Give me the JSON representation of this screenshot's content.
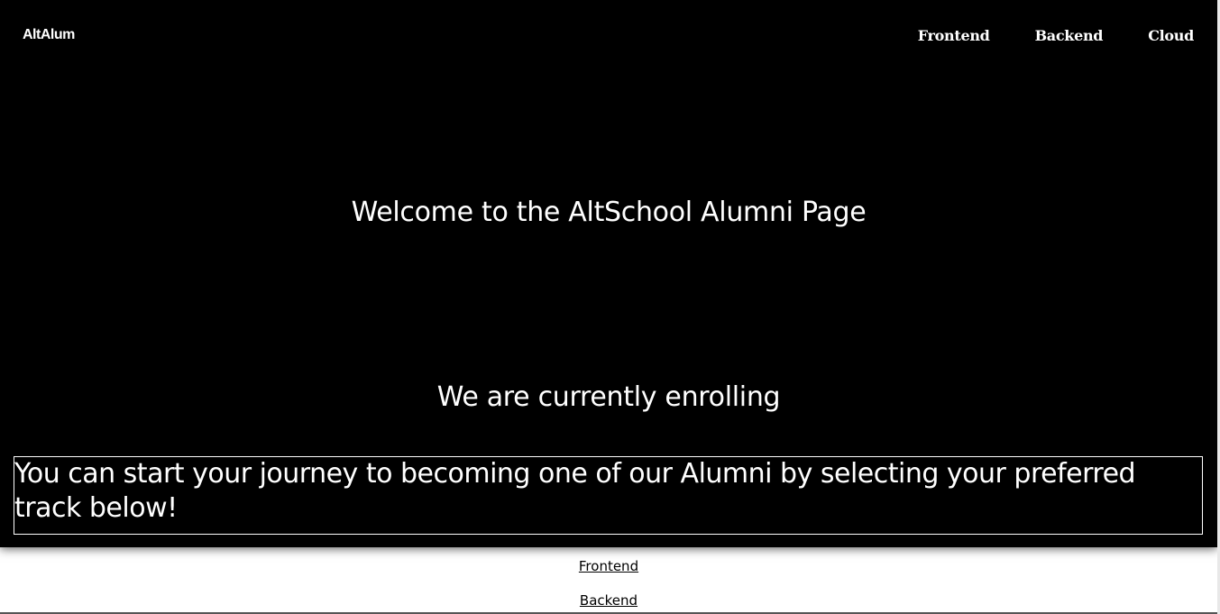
{
  "header": {
    "brand": "AltAlum",
    "nav": [
      "Frontend",
      "Backend",
      "Cloud"
    ]
  },
  "hero": {
    "welcome": "Welcome to the AltSchool Alumni Page",
    "enrolling": "We are currently enrolling",
    "journey": "You can start your journey to becoming one of our Alumni by selecting your preferred track below!"
  },
  "tracks": [
    "Frontend",
    "Backend"
  ],
  "colors": {
    "hero_background": "#000000",
    "text_on_hero": "#ffffff",
    "page_background": "#ffffff",
    "link_color": "#000000"
  }
}
